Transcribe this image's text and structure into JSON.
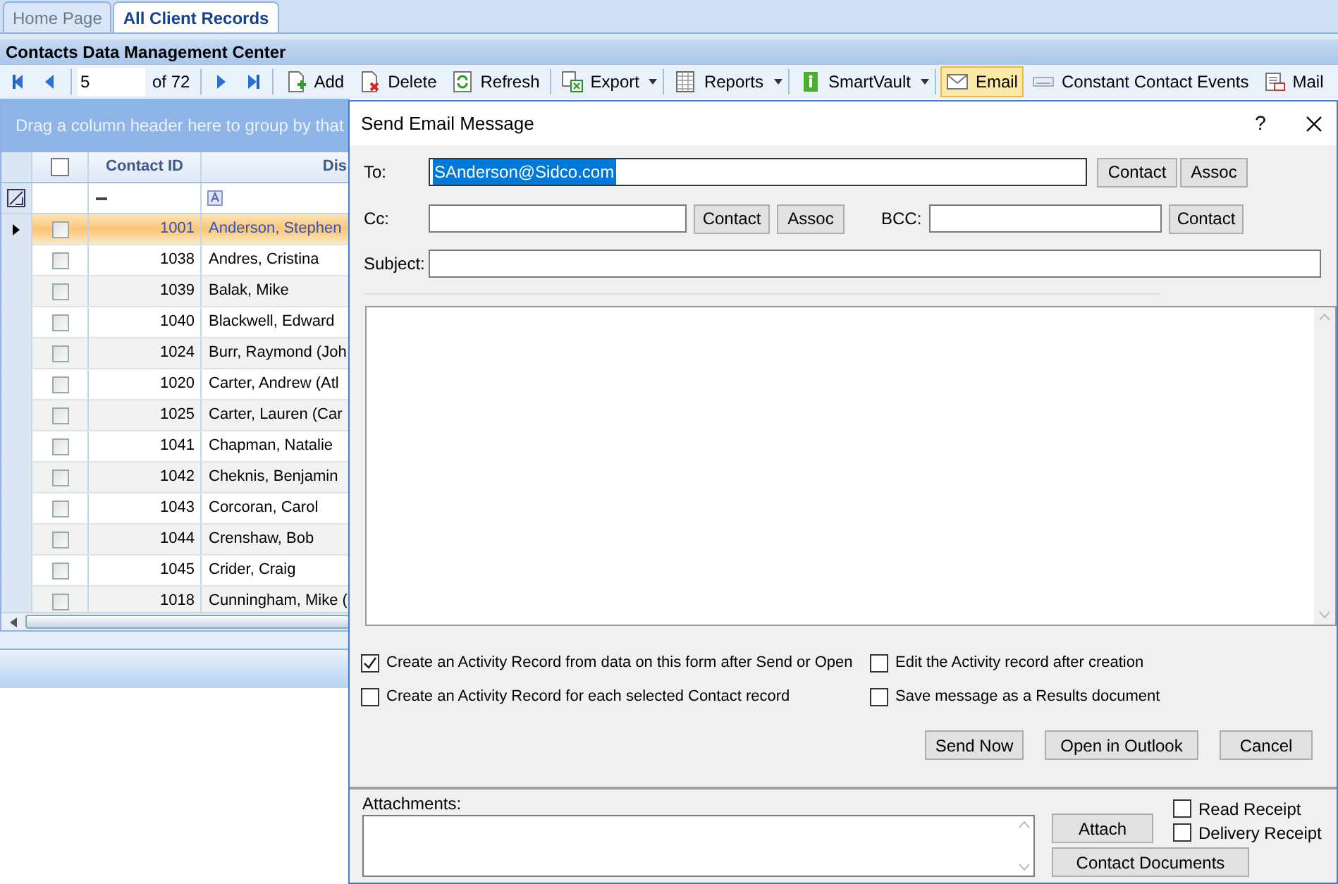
{
  "tabs": [
    {
      "label": "Home Page",
      "selected": false
    },
    {
      "label": "All Client Records",
      "selected": true
    }
  ],
  "header": {
    "title": "Contacts Data Management Center"
  },
  "toolbar": {
    "page": "5",
    "page_count": "of 72",
    "items": [
      {
        "kind": "add",
        "label": "Add",
        "dropdown": false,
        "active": false
      },
      {
        "kind": "delete",
        "label": "Delete",
        "dropdown": false,
        "active": false
      },
      {
        "kind": "refresh",
        "label": "Refresh",
        "dropdown": false,
        "active": false
      },
      {
        "kind": "export",
        "label": "Export",
        "dropdown": true,
        "active": false
      },
      {
        "kind": "reports",
        "label": "Reports",
        "dropdown": true,
        "active": false
      },
      {
        "kind": "vault",
        "label": "SmartVault",
        "dropdown": true,
        "active": false
      },
      {
        "kind": "email",
        "label": "Email",
        "dropdown": false,
        "active": true
      },
      {
        "kind": "events",
        "label": "Constant Contact Events",
        "dropdown": false,
        "active": false
      },
      {
        "kind": "mail",
        "label": "Mail",
        "dropdown": false,
        "active": false
      }
    ]
  },
  "grid": {
    "select_all_checked": false,
    "group_hint": "Drag a column header here to group by that",
    "columns": [
      "Contact ID",
      "Dis"
    ],
    "rows": [
      {
        "id": "1001",
        "name": "Anderson, Stephen",
        "selected": true,
        "checked": false
      },
      {
        "id": "1038",
        "name": "Andres, Cristina",
        "selected": false,
        "checked": false
      },
      {
        "id": "1039",
        "name": "Balak, Mike",
        "selected": false,
        "checked": false
      },
      {
        "id": "1040",
        "name": "Blackwell, Edward",
        "selected": false,
        "checked": false
      },
      {
        "id": "1024",
        "name": "Burr, Raymond (Joh",
        "selected": false,
        "checked": false
      },
      {
        "id": "1020",
        "name": "Carter, Andrew (Atl",
        "selected": false,
        "checked": false
      },
      {
        "id": "1025",
        "name": "Carter, Lauren (Car",
        "selected": false,
        "checked": false
      },
      {
        "id": "1041",
        "name": "Chapman, Natalie",
        "selected": false,
        "checked": false
      },
      {
        "id": "1042",
        "name": "Cheknis, Benjamin",
        "selected": false,
        "checked": false
      },
      {
        "id": "1043",
        "name": "Corcoran, Carol",
        "selected": false,
        "checked": false
      },
      {
        "id": "1044",
        "name": "Crenshaw, Bob",
        "selected": false,
        "checked": false
      },
      {
        "id": "1045",
        "name": "Crider, Craig",
        "selected": false,
        "checked": false
      },
      {
        "id": "1018",
        "name": "Cunningham, Mike (",
        "selected": false,
        "checked": false
      }
    ]
  },
  "dialog": {
    "title": "Send Email Message",
    "help": "?",
    "to": {
      "label": "To:",
      "value": "SAnderson@Sidco.com",
      "buttons": [
        "Contact",
        "Assoc"
      ]
    },
    "cc": {
      "label": "Cc:",
      "buttons": [
        "Contact",
        "Assoc"
      ]
    },
    "bcc": {
      "label": "BCC:",
      "buttons": [
        "Contact"
      ]
    },
    "subject": {
      "label": "Subject:"
    },
    "options": [
      {
        "label": "Create an Activity Record from data on this form after Send or Open",
        "checked": true
      },
      {
        "label": "Edit the Activity record after creation",
        "checked": false
      },
      {
        "label": "Create an Activity Record for each selected Contact record",
        "checked": false
      },
      {
        "label": "Save message as a Results document",
        "checked": false
      }
    ],
    "actions": [
      "Send Now",
      "Open in Outlook",
      "Cancel"
    ],
    "attachments": {
      "label": "Attachments:",
      "attach": "Attach",
      "documents": "Contact Documents",
      "receipts": [
        {
          "label": "Read Receipt",
          "checked": false
        },
        {
          "label": "Delivery Receipt",
          "checked": false
        }
      ]
    }
  }
}
